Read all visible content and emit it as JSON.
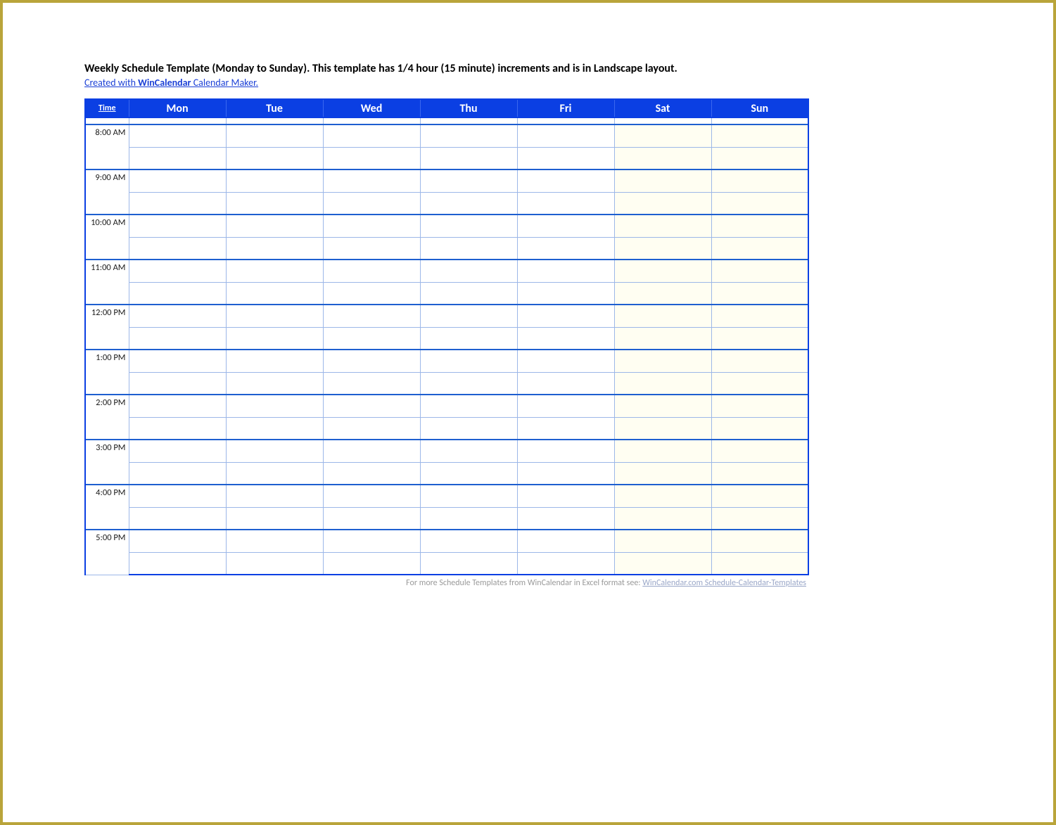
{
  "header": {
    "title": "Weekly Schedule Template (Monday to Sunday).  This template has 1/4 hour (15 minute) increments and is in Landscape layout.",
    "subtitle_prefix": "Created with ",
    "subtitle_bold": "WinCalendar",
    "subtitle_suffix": " Calendar Maker."
  },
  "table": {
    "time_header": "Time",
    "days": [
      "Mon",
      "Tue",
      "Wed",
      "Thu",
      "Fri",
      "Sat",
      "Sun"
    ],
    "times": [
      "8:00 AM",
      "9:00 AM",
      "10:00 AM",
      "11:00 AM",
      "12:00 PM",
      "1:00 PM",
      "2:00 PM",
      "3:00 PM",
      "4:00 PM",
      "5:00 PM"
    ]
  },
  "footer": {
    "text": "For more Schedule Templates from WinCalendar in Excel format see:  ",
    "link_text": "WinCalendar.com Schedule-Calendar-Templates"
  }
}
